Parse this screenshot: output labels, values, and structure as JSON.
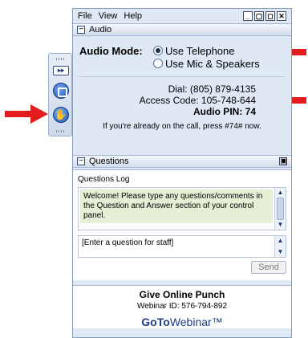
{
  "menu": {
    "items": [
      "File",
      "View",
      "Help"
    ]
  },
  "window_controls": {
    "minimize": "_",
    "restore": "▢",
    "max": "◻",
    "close": "✕"
  },
  "audio": {
    "section_label": "Audio",
    "mode_label": "Audio Mode:",
    "options": [
      {
        "label": "Use Telephone",
        "selected": true
      },
      {
        "label": "Use Mic & Speakers",
        "selected": false
      }
    ],
    "dial": "Dial:  (805) 879-4135",
    "access_code": "Access Code:  105-748-644",
    "pin": "Audio PIN:  74",
    "note": "If you're already on the call, press #74# now."
  },
  "questions": {
    "section_label": "Questions",
    "log_label": "Questions Log",
    "welcome": "Welcome! Please type any questions/comments in the Question and Answer section of your control panel.",
    "input_placeholder": "[Enter a question for staff]",
    "send_label": "Send"
  },
  "footer": {
    "title": "Give Online Punch",
    "webinar_id": "Webinar ID: 576-794-892",
    "logo_go": "GoTo",
    "logo_webinar": "Webinar™"
  },
  "minibar": {
    "expand_label": "▸▸"
  },
  "colors": {
    "arrow": "#e41c1c",
    "panel_bg": "#dfe8f5",
    "welcome_bg": "#e4efd6"
  }
}
